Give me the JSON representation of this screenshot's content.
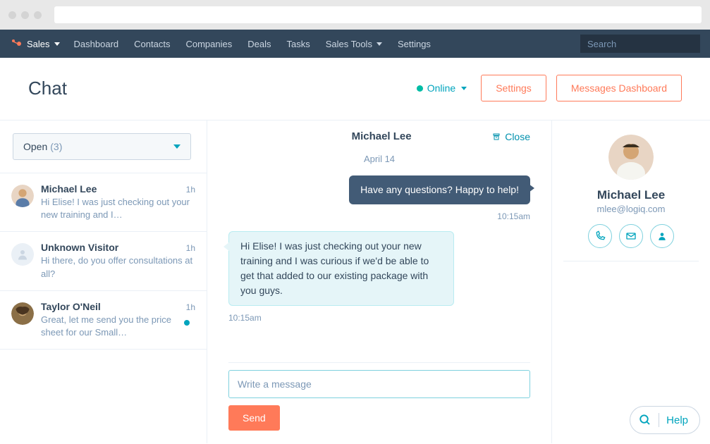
{
  "nav": {
    "brand": "Sales",
    "items": [
      "Dashboard",
      "Contacts",
      "Companies",
      "Deals",
      "Tasks",
      "Sales Tools",
      "Settings"
    ],
    "search_placeholder": "Search"
  },
  "header": {
    "title": "Chat",
    "status": "Online",
    "settings_btn": "Settings",
    "messages_btn": "Messages Dashboard"
  },
  "sidebar": {
    "filter_label": "Open",
    "filter_count": "(3)",
    "conversations": [
      {
        "name": "Michael Lee",
        "time": "1h",
        "preview": "Hi Elise! I was just checking out your new training and I…",
        "avatar_type": "person",
        "avatar_hint": "male-short-hair"
      },
      {
        "name": "Unknown Visitor",
        "time": "1h",
        "preview": "Hi there, do you offer consultations at all?",
        "avatar_type": "unknown"
      },
      {
        "name": "Taylor O'Neil",
        "time": "1h",
        "preview": "Great, let me send you the price sheet for our Small…",
        "avatar_type": "person",
        "avatar_hint": "female-curly-hair",
        "unread": true
      }
    ]
  },
  "chat": {
    "header_name": "Michael Lee",
    "close_label": "Close",
    "date": "April 14",
    "messages": [
      {
        "side": "agent",
        "text": "Have any questions? Happy to help!",
        "time": "10:15am"
      },
      {
        "side": "visitor",
        "text": "Hi Elise! I was just checking out your new training and I was curious if we'd be able to get that added to our existing package with you guys.",
        "time": "10:15am"
      }
    ],
    "compose_placeholder": "Write a message",
    "send_label": "Send"
  },
  "contact": {
    "name": "Michael Lee",
    "email": "mlee@logiq.com"
  },
  "help": {
    "label": "Help"
  },
  "colors": {
    "accent": "#ff7a59",
    "teal": "#00a4bd"
  }
}
